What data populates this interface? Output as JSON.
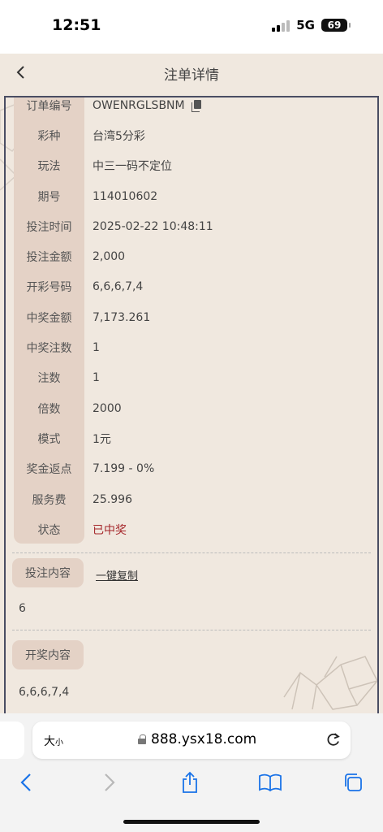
{
  "status": {
    "time": "12:51",
    "network": "5G",
    "battery": "69"
  },
  "nav": {
    "title": "注单详情"
  },
  "details": [
    {
      "label": "订单编号",
      "value": "OWENRGLSBNM",
      "copyable": true
    },
    {
      "label": "彩种",
      "value": "台湾5分彩"
    },
    {
      "label": "玩法",
      "value": "中三一码不定位"
    },
    {
      "label": "期号",
      "value": "114010602"
    },
    {
      "label": "投注时间",
      "value": "2025-02-22 10:48:11"
    },
    {
      "label": "投注金额",
      "value": "2,000"
    },
    {
      "label": "开彩号码",
      "value": "6,6,6,7,4"
    },
    {
      "label": "中奖金额",
      "value": "7,173.261"
    },
    {
      "label": "中奖注数",
      "value": "1"
    },
    {
      "label": "注数",
      "value": "1"
    },
    {
      "label": "倍数",
      "value": "2000"
    },
    {
      "label": "模式",
      "value": "1元"
    },
    {
      "label": "奖金返点",
      "value": "7.199 - 0%"
    },
    {
      "label": "服务费",
      "value": "25.996"
    },
    {
      "label": "状态",
      "value": "已中奖",
      "status_color": "#a5262a"
    }
  ],
  "bet_content": {
    "label": "投注内容",
    "copy_link": "一键复制",
    "value": "6"
  },
  "draw_content": {
    "label": "开奖内容",
    "value": "6,6,6,7,4"
  },
  "browser": {
    "text_size_label": "大",
    "text_size_small": "小",
    "url": "888.ysx18.com"
  },
  "colors": {
    "accent_chip": "#e4d2c6",
    "win_red": "#a5262a",
    "panel_border": "#4a4d63"
  }
}
